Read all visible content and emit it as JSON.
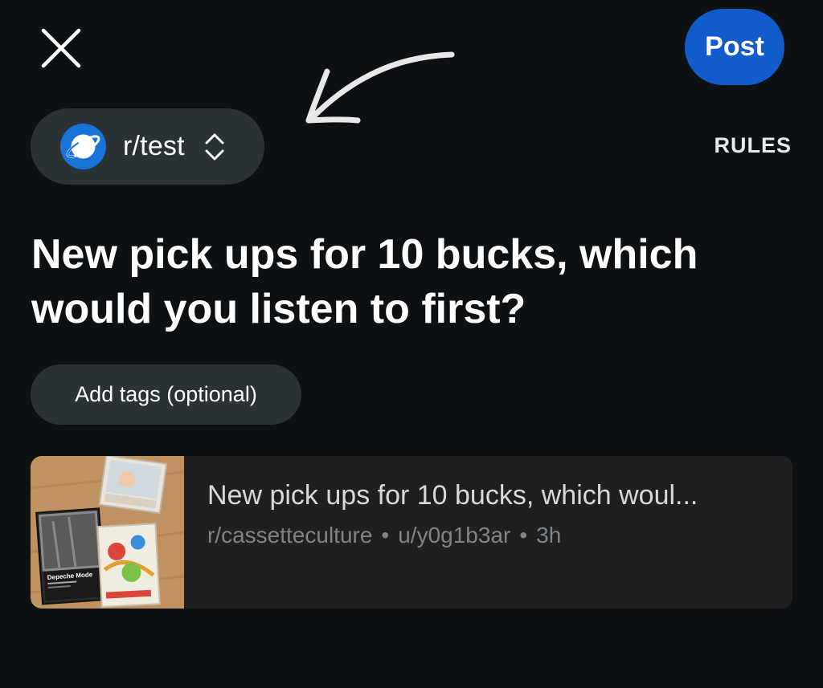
{
  "header": {
    "close_icon": "close-icon",
    "post_label": "Post",
    "accent_color": "#115bca"
  },
  "community": {
    "name": "r/test",
    "avatar_icon": "planet-icon",
    "selector_icon": "chevron-up-down-icon"
  },
  "rules_label": "RULES",
  "post": {
    "title": "New pick ups for 10 bucks, which would you listen to first?"
  },
  "tags_label": "Add tags (optional)",
  "crosspost": {
    "title": "New pick ups for 10 bucks, which woul...",
    "subreddit": "r/cassetteculture",
    "separator": "•",
    "author": "u/y0g1b3ar",
    "age": "3h",
    "thumbnail_cassette_label": "Depeche Mode"
  }
}
